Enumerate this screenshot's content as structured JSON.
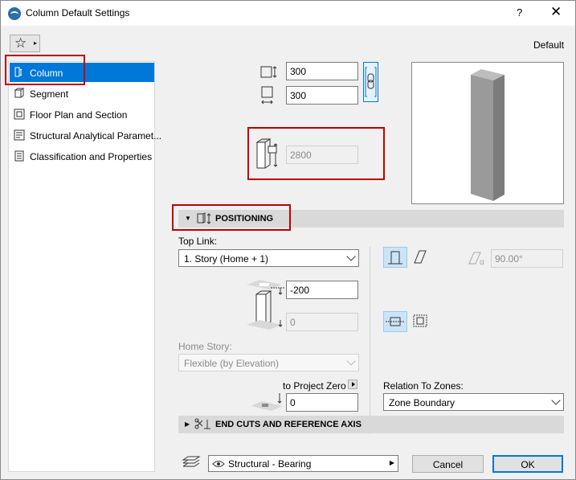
{
  "window": {
    "title": "Column Default Settings",
    "help_label": "?",
    "close_label": "✕",
    "default_label": "Default"
  },
  "favorites": {
    "icon": "star-icon",
    "arrow": "▸"
  },
  "sidebar": {
    "items": [
      {
        "label": "Column",
        "icon": "column-icon",
        "selected": true
      },
      {
        "label": "Segment",
        "icon": "segment-icon",
        "selected": false
      },
      {
        "label": "Floor Plan and Section",
        "icon": "floor-plan-icon",
        "selected": false
      },
      {
        "label": "Structural Analytical Paramet...",
        "icon": "structural-analytical-icon",
        "selected": false
      },
      {
        "label": "Classification and Properties",
        "icon": "classification-icon",
        "selected": false
      }
    ]
  },
  "geometry": {
    "width_value": "300",
    "depth_value": "300",
    "height_value": "2800"
  },
  "positioning": {
    "header": "POSITIONING",
    "top_link_label": "Top Link:",
    "top_link_value": "1. Story (Home + 1)",
    "top_offset_value": "-200",
    "bottom_offset_value": "0",
    "angle_value": "90.00°",
    "home_story_label": "Home Story:",
    "home_story_value": "Flexible (by Elevation)",
    "to_project_zero_label": "to Project Zero",
    "to_project_zero_value": "0",
    "relation_to_zones_label": "Relation To Zones:",
    "relation_to_zones_value": "Zone Boundary"
  },
  "end_cuts": {
    "header": "END CUTS AND REFERENCE AXIS"
  },
  "footer": {
    "layer_value": "Structural - Bearing",
    "cancel_label": "Cancel",
    "ok_label": "OK"
  },
  "colors": {
    "selection": "#0078d7",
    "annotation_red": "#c00000",
    "section_bar": "#d9d9d9"
  }
}
